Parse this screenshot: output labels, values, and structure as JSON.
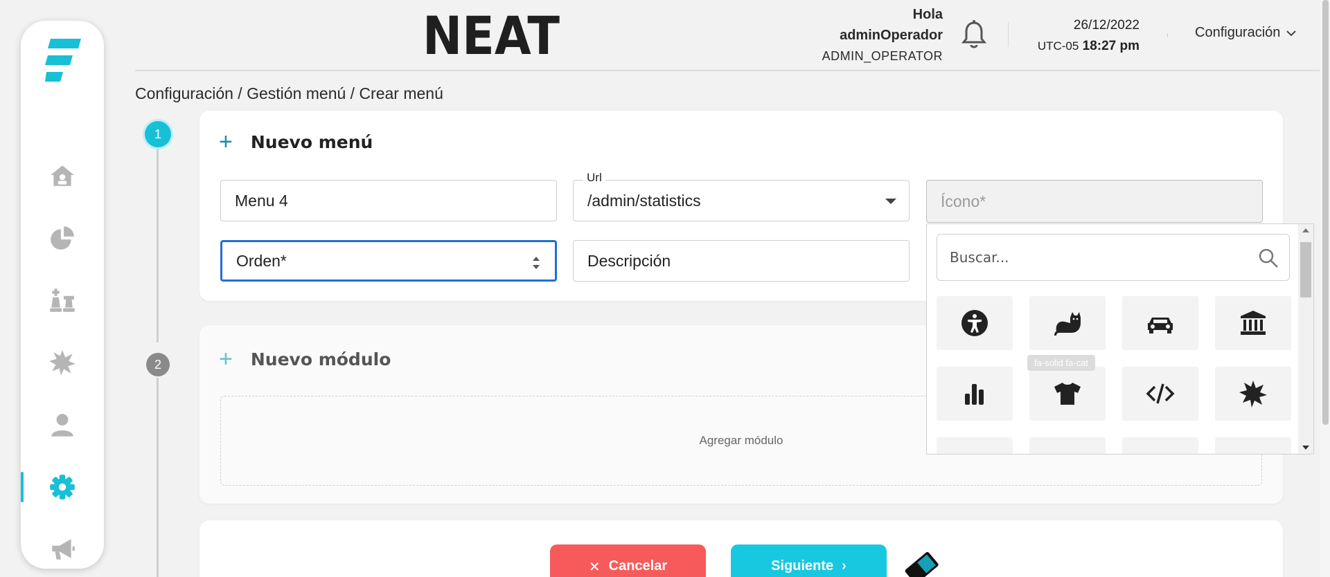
{
  "header": {
    "brand": "NEAT",
    "greeting": "Hola",
    "username": "adminOperador",
    "role": "ADMIN_OPERATOR",
    "date": "26/12/2022",
    "timezone": "UTC-05",
    "time": "18:27 pm",
    "config_menu_label": "Configuración"
  },
  "breadcrumb": "Configuración / Gestión menú / Crear menú",
  "sidebar": {
    "items": [
      {
        "name": "home",
        "icon": "home-icon"
      },
      {
        "name": "statistics",
        "icon": "pie-chart-icon"
      },
      {
        "name": "strategy",
        "icon": "chess-icon"
      },
      {
        "name": "burst",
        "icon": "burst-icon"
      },
      {
        "name": "users",
        "icon": "user-icon"
      },
      {
        "name": "settings",
        "icon": "gear-icon",
        "active": true
      },
      {
        "name": "announcements",
        "icon": "megaphone-icon"
      }
    ]
  },
  "steps": [
    "1",
    "2"
  ],
  "menu_form": {
    "title": "Nuevo menú",
    "name_value": "Menu 4",
    "url_label": "Url",
    "url_value": "/admin/statistics",
    "icon_placeholder": "Ícono*",
    "order_placeholder": "Orden*",
    "description_placeholder": "Descripción"
  },
  "icon_picker": {
    "search_placeholder": "Buscar...",
    "tooltip": "fa-solid fa-cat",
    "icons": [
      "universal-access-icon",
      "cat-icon",
      "car-icon",
      "bank-icon",
      "bar-chart-icon",
      "shirt-icon",
      "code-icon",
      "burst-icon"
    ]
  },
  "module_form": {
    "title": "Nuevo módulo",
    "add_label": "Agregar módulo"
  },
  "actions": {
    "cancel_label": "Cancelar",
    "next_label": "Siguiente"
  },
  "colors": {
    "accent": "#17c0d6",
    "cancel": "#f75a5a",
    "next": "#17c8e0",
    "focus": "#1f6fd6"
  }
}
